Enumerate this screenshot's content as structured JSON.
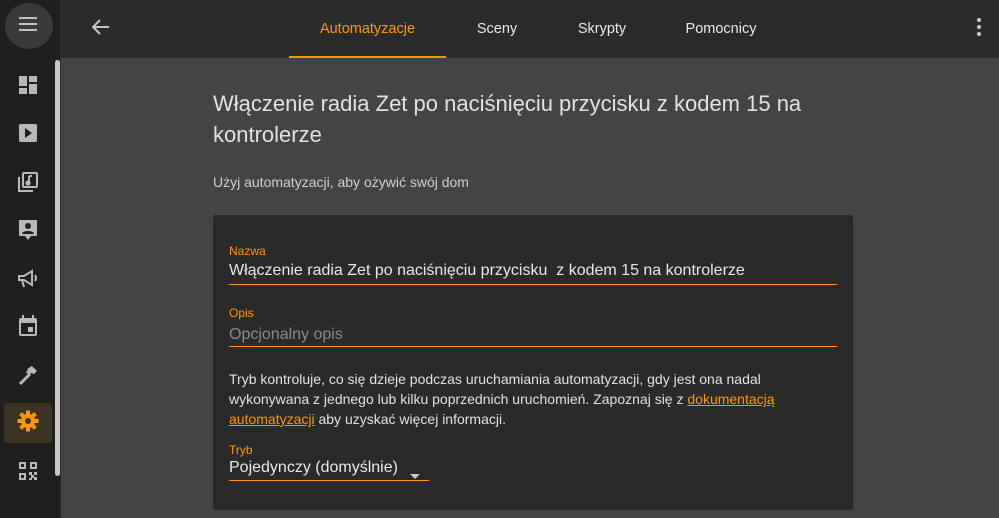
{
  "colors": {
    "accent": "#ff9800",
    "sidebar_bg": "#1f1f1f",
    "header_bg": "#2b2b2b",
    "page_bg": "#444444",
    "card_bg": "#2a2a2a"
  },
  "sidebar": {
    "menu_icon": "hamburger-menu-icon",
    "items": [
      {
        "icon": "dashboard-icon",
        "active": false
      },
      {
        "icon": "media-player-icon",
        "active": false
      },
      {
        "icon": "media-library-icon",
        "active": false
      },
      {
        "icon": "user-badge-icon",
        "active": false
      },
      {
        "icon": "megaphone-icon",
        "active": false
      },
      {
        "icon": "calendar-icon",
        "active": false
      },
      {
        "icon": "hammer-icon",
        "active": false
      },
      {
        "icon": "gear-icon",
        "active": true
      },
      {
        "icon": "qr-code-icon",
        "active": false
      }
    ]
  },
  "header": {
    "back_icon": "arrow-left-icon",
    "tabs": [
      {
        "label": "Automatyzacje",
        "active": true
      },
      {
        "label": "Sceny",
        "active": false
      },
      {
        "label": "Skrypty",
        "active": false
      },
      {
        "label": "Pomocnicy",
        "active": false
      }
    ],
    "overflow_icon": "dots-vertical-icon"
  },
  "page": {
    "title": "Włączenie radia Zet po naciśnięciu przycisku z kodem 15 na kontrolerze",
    "subtitle": "Użyj automatyzacji, aby ożywić swój dom"
  },
  "form": {
    "name_label": "Nazwa",
    "name_value": "Włączenie radia Zet po naciśnięciu przycisku  z kodem 15 na kontrolerze",
    "description_label": "Opis",
    "description_value": "",
    "description_placeholder": "Opcjonalny opis",
    "mode_description": {
      "before": "Tryb kontroluje, co się dzieje podczas uruchamiania automatyzacji, gdy jest ona nadal wykonywana z jednego lub kilku poprzednich uruchomień. Zapoznaj się z ",
      "link": "dokumentacją automatyzacji",
      "after": " aby uzyskać więcej informacji."
    },
    "mode_label": "Tryb",
    "mode_value": "Pojedynczy (domyślnie)",
    "mode_dropdown_icon": "caret-down-icon"
  }
}
